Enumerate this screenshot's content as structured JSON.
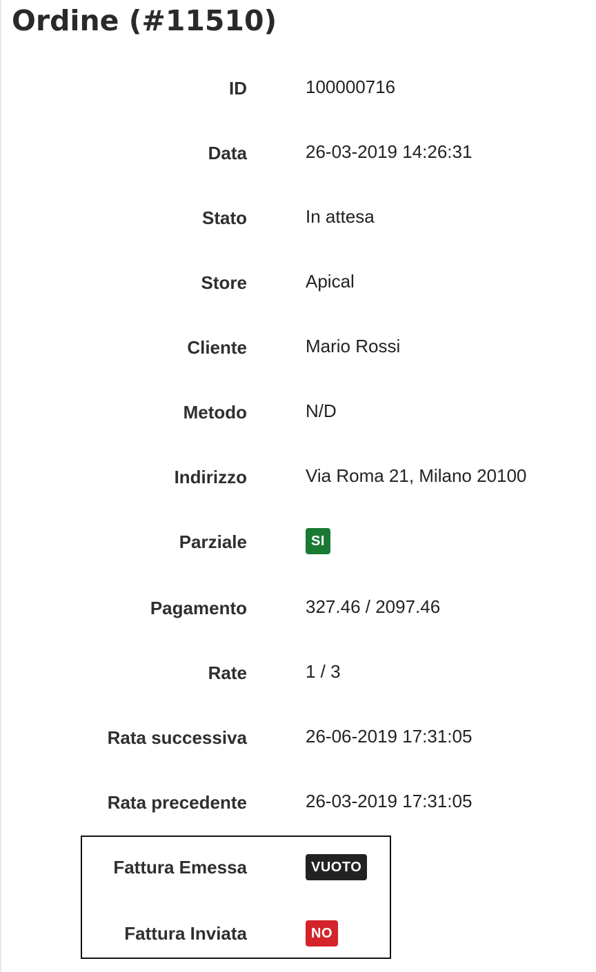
{
  "page": {
    "title": "Ordine (#11510)"
  },
  "fields": {
    "id": {
      "label": "ID",
      "value": "100000716"
    },
    "data": {
      "label": "Data",
      "value": "26-03-2019 14:26:31"
    },
    "stato": {
      "label": "Stato",
      "value": "In attesa"
    },
    "store": {
      "label": "Store",
      "value": "Apical"
    },
    "cliente": {
      "label": "Cliente",
      "value": "Mario Rossi"
    },
    "metodo": {
      "label": "Metodo",
      "value": "N/D"
    },
    "indirizzo": {
      "label": "Indirizzo",
      "value": "Via Roma 21, Milano 20100"
    },
    "parziale": {
      "label": "Parziale",
      "badge": "SI",
      "badge_color": "#1a7a34"
    },
    "pagamento": {
      "label": "Pagamento",
      "value": "327.46 / 2097.46"
    },
    "rate": {
      "label": "Rate",
      "value": "1 / 3"
    },
    "rata_successiva": {
      "label": "Rata successiva",
      "value": "26-06-2019 17:31:05"
    },
    "rata_precedente": {
      "label": "Rata precedente",
      "value": "26-03-2019 17:31:05"
    },
    "fattura_emessa": {
      "label": "Fattura Emessa",
      "badge": "VUOTO",
      "badge_color": "#222222"
    },
    "fattura_inviata": {
      "label": "Fattura Inviata",
      "badge": "NO",
      "badge_color": "#d4232b"
    }
  }
}
